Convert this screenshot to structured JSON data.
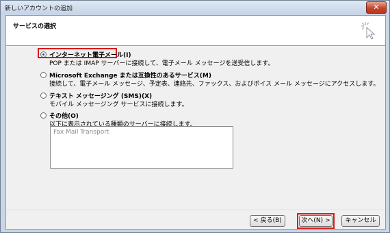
{
  "window": {
    "title": "新しいアカウントの追加",
    "close_glyph": "✕"
  },
  "header": {
    "title": "サービスの選択",
    "icon": "wizard-cursor-icon"
  },
  "options": [
    {
      "label": "インターネット電子メール(I)",
      "description": "POP または IMAP サーバーに接続して、電子メール メッセージを送受信します。",
      "selected": true
    },
    {
      "label": "Microsoft Exchange または互換性のあるサービス(M)",
      "description": "接続して、電子メール メッセージ、予定表、連絡先、ファックス、およびボイス メール メッセージにアクセスします。",
      "selected": false
    },
    {
      "label": "テキスト メッセージング (SMS)(X)",
      "description": "モバイル メッセージング サービスに接続します。",
      "selected": false
    },
    {
      "label": "その他(O)",
      "description": "以下に表示されている種類のサーバーに接続します。",
      "selected": false
    }
  ],
  "other_list": {
    "items": [
      "Fax Mail Transport"
    ]
  },
  "buttons": {
    "back": "< 戻る(B)",
    "next": "次へ(N) >",
    "cancel": "キャンセル"
  },
  "colors": {
    "highlight": "#d81a1a",
    "title_bar": "#c9d6e6"
  }
}
